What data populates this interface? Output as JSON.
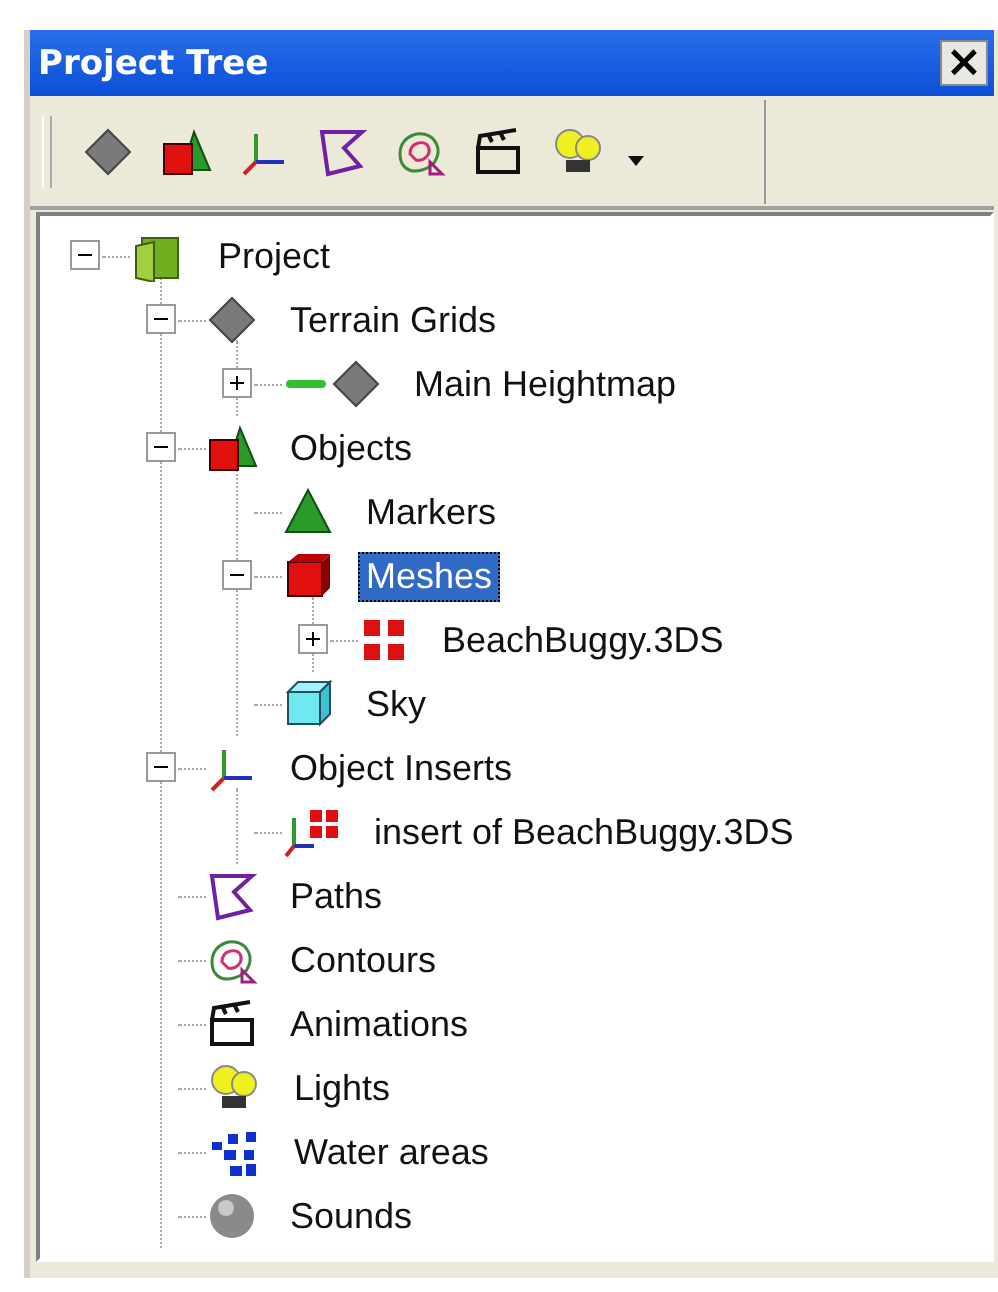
{
  "window": {
    "title": "Project Tree",
    "close": "×"
  },
  "toolbar": {
    "buttons": [
      {
        "kind": "terrain"
      },
      {
        "kind": "objects"
      },
      {
        "kind": "axes"
      },
      {
        "kind": "paths"
      },
      {
        "kind": "contours"
      },
      {
        "kind": "clapper"
      },
      {
        "kind": "lights"
      },
      {
        "kind": "dropdown"
      }
    ]
  },
  "tree": {
    "items": [
      {
        "label": "Project",
        "kind": "project",
        "expanded": true,
        "selected": false,
        "children": [
          {
            "label": "Terrain Grids",
            "kind": "terrain",
            "expanded": true,
            "selected": false,
            "children": [
              {
                "label": "Main Heightmap",
                "kind": "heightmap",
                "expanded": false,
                "selected": false
              }
            ]
          },
          {
            "label": "Objects",
            "kind": "objects",
            "expanded": true,
            "selected": false,
            "children": [
              {
                "label": "Markers",
                "kind": "marker",
                "selected": false
              },
              {
                "label": "Meshes",
                "kind": "mesh",
                "expanded": true,
                "selected": true,
                "children": [
                  {
                    "label": "BeachBuggy.3DS",
                    "kind": "parts",
                    "expanded": false,
                    "selected": false
                  }
                ]
              },
              {
                "label": "Sky",
                "kind": "sky",
                "selected": false
              }
            ]
          },
          {
            "label": "Object Inserts",
            "kind": "axes",
            "expanded": true,
            "selected": false,
            "children": [
              {
                "label": "insert of BeachBuggy.3DS",
                "kind": "insert",
                "selected": false
              }
            ]
          },
          {
            "label": "Paths",
            "kind": "paths",
            "selected": false
          },
          {
            "label": "Contours",
            "kind": "contours",
            "selected": false
          },
          {
            "label": "Animations",
            "kind": "clapper",
            "selected": false
          },
          {
            "label": "Lights",
            "kind": "lights",
            "selected": false
          },
          {
            "label": "Water areas",
            "kind": "water",
            "selected": false
          },
          {
            "label": "Sounds",
            "kind": "sounds",
            "selected": false
          }
        ]
      }
    ]
  }
}
